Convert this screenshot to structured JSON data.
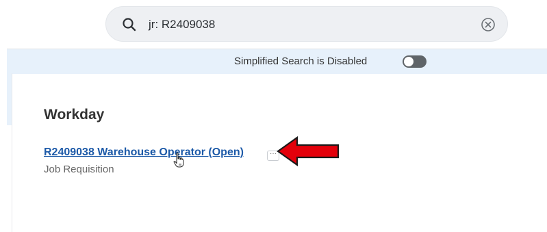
{
  "search": {
    "query": "jr: R2409038"
  },
  "banner": {
    "text": "Simplified Search is Disabled",
    "toggle_state": "off"
  },
  "results": {
    "section_title": "Workday",
    "items": [
      {
        "title": "R2409038 Warehouse Operator (Open)",
        "subtitle": "Job Requisition",
        "more_label": "···"
      }
    ]
  },
  "colors": {
    "link": "#1d5aa8",
    "banner_bg": "#e7f1fb",
    "arrow": "#e3000b"
  },
  "icons": [
    "search-icon",
    "clear-icon",
    "more-icon",
    "hand-cursor-icon",
    "red-arrow-annotation"
  ]
}
